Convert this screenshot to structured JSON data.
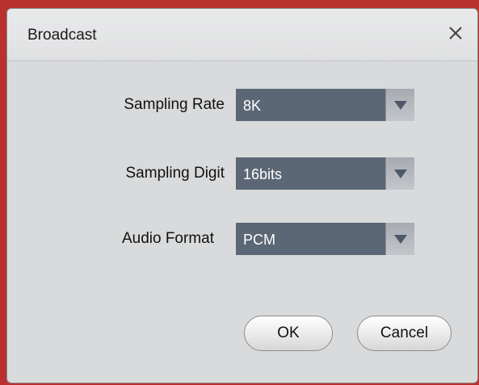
{
  "dialog": {
    "title": "Broadcast",
    "close_icon": "close-icon"
  },
  "fields": [
    {
      "label": "Sampling Rate",
      "value": "8K"
    },
    {
      "label": "Sampling Digit",
      "value": "16bits"
    },
    {
      "label": "Audio Format",
      "value": "PCM"
    }
  ],
  "buttons": {
    "ok_label": "OK",
    "cancel_label": "Cancel"
  },
  "colors": {
    "select_background": "#5c6775",
    "dialog_background": "#d9dadb",
    "desktop_background": "#b8312f"
  }
}
